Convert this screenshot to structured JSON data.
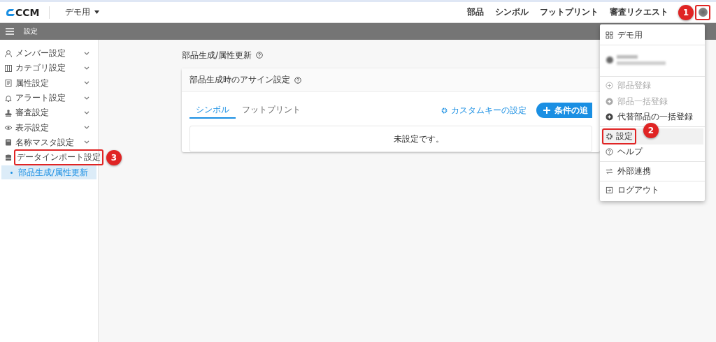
{
  "header": {
    "logo": "CCM",
    "workspace": "デモ用",
    "nav": [
      "部品",
      "シンボル",
      "フットプリント",
      "審査リクエスト"
    ],
    "callout": "1"
  },
  "settings_bar": {
    "title": "設定"
  },
  "sidebar": {
    "items": [
      {
        "label": "メンバー設定",
        "expanded": false
      },
      {
        "label": "カテゴリ設定",
        "expanded": false
      },
      {
        "label": "属性設定",
        "expanded": false
      },
      {
        "label": "アラート設定",
        "expanded": false
      },
      {
        "label": "審査設定",
        "expanded": false
      },
      {
        "label": "表示設定",
        "expanded": false
      },
      {
        "label": "名称マスタ設定",
        "expanded": false
      },
      {
        "label": "データインポート設定",
        "expanded": true,
        "callout": "3",
        "children": [
          {
            "label": "部品生成/属性更新",
            "selected": true
          }
        ]
      }
    ]
  },
  "main": {
    "page_title": "部品生成/属性更新",
    "card_title": "部品生成時のアサイン設定",
    "tabs": [
      {
        "label": "シンボル",
        "selected": true
      },
      {
        "label": "フットプリント",
        "selected": false
      }
    ],
    "custom_key_link": "カスタムキーの設定",
    "add_button": "条件の追",
    "empty_message": "未設定です。"
  },
  "user_menu": {
    "groups": [
      [
        {
          "kind": "item",
          "label": "デモ用",
          "disabled": false,
          "highlighted": false
        }
      ],
      [
        {
          "kind": "account"
        }
      ],
      [
        {
          "kind": "item",
          "label": "部品登録",
          "disabled": true,
          "highlighted": false
        },
        {
          "kind": "item",
          "label": "部品一括登録",
          "disabled": true,
          "highlighted": false
        },
        {
          "kind": "item",
          "label": "代替部品の一括登録",
          "disabled": false,
          "highlighted": false
        }
      ],
      [
        {
          "kind": "item",
          "label": "設定",
          "disabled": false,
          "highlighted": true,
          "callout": "2"
        },
        {
          "kind": "item",
          "label": "ヘルプ",
          "disabled": false,
          "highlighted": false
        }
      ],
      [
        {
          "kind": "item",
          "label": "外部連携",
          "disabled": false,
          "highlighted": false
        }
      ],
      [
        {
          "kind": "item",
          "label": "ログアウト",
          "disabled": false,
          "highlighted": false
        }
      ]
    ]
  }
}
